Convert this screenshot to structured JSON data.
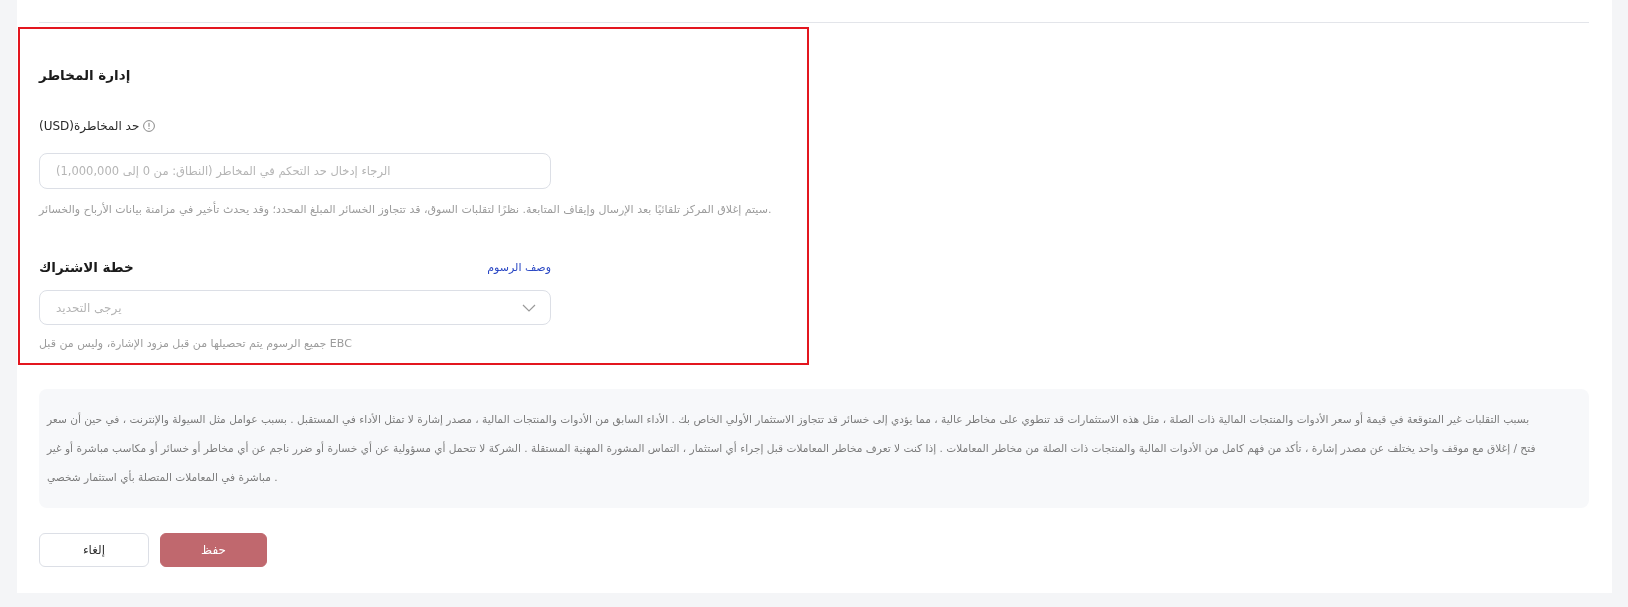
{
  "form": {
    "highlighted": true,
    "risk_management": {
      "title": "إدارة المخاطر",
      "risk_limit": {
        "label": "حد المخاطرة(USD)",
        "placeholder": "الرجاء إدخال حد التحكم في المخاطر (النطاق: من 0 إلى 1,000,000)",
        "hint": "سيتم إغلاق المركز تلقائيًا بعد الإرسال وإيقاف المتابعة. نظرًا لتقلبات السوق، قد تتجاوز الخسائر المبلغ المحدد؛ وقد يحدث تأخير في مزامنة بيانات الأرباح والخسائر."
      }
    },
    "subscription_plan": {
      "title": "خطة الاشتراك",
      "link": "وصف الرسوم",
      "select": {
        "placeholder": "يرجى التحديد"
      },
      "hint": "جميع الرسوم يتم تحصيلها من قبل مزود الإشارة، وليس من قبل EBC"
    }
  },
  "disclaimer": "بسبب التقلبات غير المتوقعة في قيمة أو سعر الأدوات والمنتجات المالية ذات الصلة ، مثل هذه الاستثمارات قد تنطوي على مخاطر عالية ، مما يؤدي إلى خسائر قد تتجاوز الاستثمار الأولي الخاص بك . الأداء السابق من الأدوات والمنتجات المالية ، مصدر إشارة لا تمثل الأداء في المستقبل . بسبب عوامل مثل السيولة والإنترنت ، في حين أن سعر فتح / إغلاق مع موقف واحد يختلف عن مصدر إشارة ، تأكد من فهم كامل من الأدوات المالية والمنتجات ذات الصلة من مخاطر المعاملات . إذا كنت لا تعرف مخاطر المعاملات قبل إجراء أي استثمار ، التماس المشورة المهنية المستقلة . الشركة لا تتحمل أي مسؤولية عن أي خسارة أو ضرر ناجم عن أي مخاطر أو خسائر أو مكاسب مباشرة أو غير مباشرة في المعاملات المتصلة بأي استثمار شخصي .",
  "buttons": [
    {
      "label": "حفظ",
      "kind": "primary"
    },
    {
      "label": "إلغاء",
      "kind": "secondary"
    }
  ]
}
